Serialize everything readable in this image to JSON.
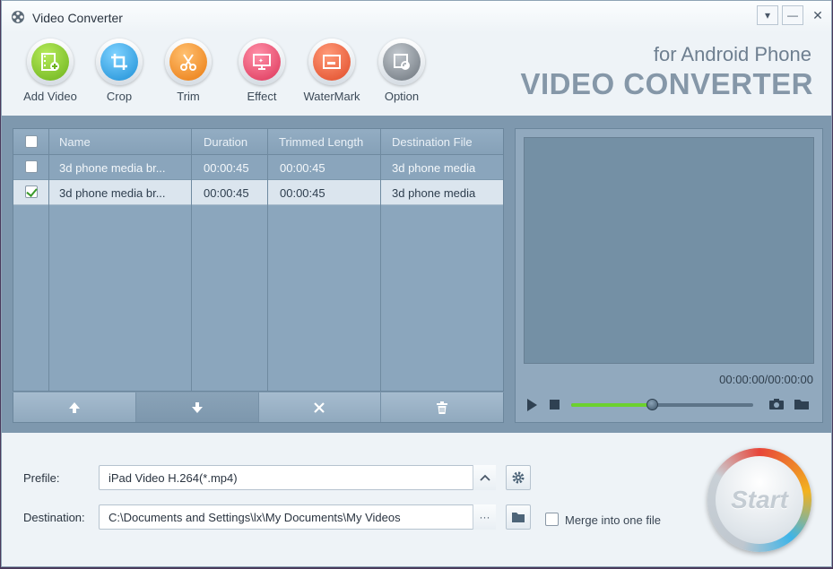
{
  "window": {
    "title": "Video Converter"
  },
  "toolbar": {
    "items": [
      {
        "label": "Add Video",
        "icon": "film-add-icon",
        "color": "#7dc22a"
      },
      {
        "label": "Crop",
        "icon": "crop-icon",
        "color": "#2aa3e6"
      },
      {
        "label": "Trim",
        "icon": "scissors-icon",
        "color": "#f28a1c"
      },
      {
        "label": "Effect",
        "icon": "effect-icon",
        "color": "#e8476a"
      },
      {
        "label": "WaterMark",
        "icon": "watermark-icon",
        "color": "#ea5a38"
      },
      {
        "label": "Option",
        "icon": "gear-icon",
        "color": "#7e8690"
      }
    ]
  },
  "brand": {
    "subtitle": "for Android Phone",
    "title": "VIDEO CONVERTER"
  },
  "file_table": {
    "columns": [
      "Name",
      "Duration",
      "Trimmed Length",
      "Destination File"
    ],
    "rows": [
      {
        "checked": false,
        "name": "3d phone media br...",
        "duration": "00:00:45",
        "trimmed": "00:00:45",
        "destination": "3d phone media"
      },
      {
        "checked": true,
        "name": "3d phone media br...",
        "duration": "00:00:45",
        "trimmed": "00:00:45",
        "destination": "3d phone media"
      }
    ]
  },
  "preview": {
    "timecode": "00:00:00/00:00:00",
    "progress": 0.45
  },
  "settings": {
    "profile_label": "Prefile:",
    "profile_value": "iPad Video H.264(*.mp4)",
    "destination_label": "Destination:",
    "destination_value": "C:\\Documents and Settings\\lx\\My Documents\\My Videos",
    "browse_label": "···",
    "merge_label": "Merge into one file"
  },
  "start": {
    "label": "Start"
  },
  "colors": {
    "panel": "#7e98ae",
    "accent_green": "#6cd12e",
    "background": "#eef3f7"
  }
}
